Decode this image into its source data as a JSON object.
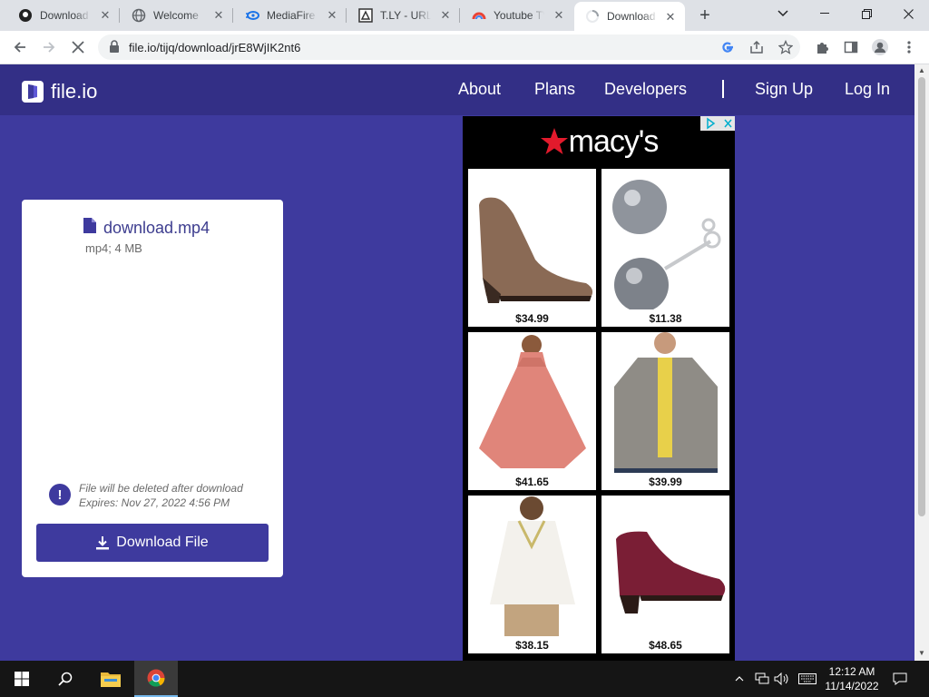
{
  "browser": {
    "tabs": [
      {
        "title": "Download"
      },
      {
        "title": "Welcome"
      },
      {
        "title": "MediaFire"
      },
      {
        "title": "T.LY - URL"
      },
      {
        "title": "Youtube TV"
      },
      {
        "title": "Download"
      }
    ],
    "address": "file.io/tijq/download/jrE8WjIK2nt6"
  },
  "site": {
    "logo_text": "file.io",
    "nav": [
      "About",
      "Plans",
      "Developers",
      "Sign Up",
      "Log In"
    ]
  },
  "file": {
    "name": "download.mp4",
    "meta": "mp4; 4 MB",
    "notice_line1": "File will be deleted after download",
    "notice_line2": "Expires: Nov 27, 2022 4:56 PM",
    "download_label": "Download File"
  },
  "ad": {
    "brand": "macy's",
    "products": [
      {
        "item": "ankle boot brown",
        "price": "$34.99"
      },
      {
        "item": "pearl earrings",
        "price": "$11.38"
      },
      {
        "item": "pink poncho sweater",
        "price": "$41.65"
      },
      {
        "item": "quilted jacket",
        "price": "$39.99"
      },
      {
        "item": "white embroidered tunic",
        "price": "$38.15"
      },
      {
        "item": "burgundy suede bootie",
        "price": "$48.65"
      }
    ]
  },
  "taskbar": {
    "time": "12:12 AM",
    "date": "11/14/2022"
  },
  "colors": {
    "page_bg": "#3e3a9e",
    "nav_bg": "#332f86",
    "button_bg": "#3e3a9e",
    "filename": "#3d3d8f",
    "macys_red": "#e21a2c"
  }
}
